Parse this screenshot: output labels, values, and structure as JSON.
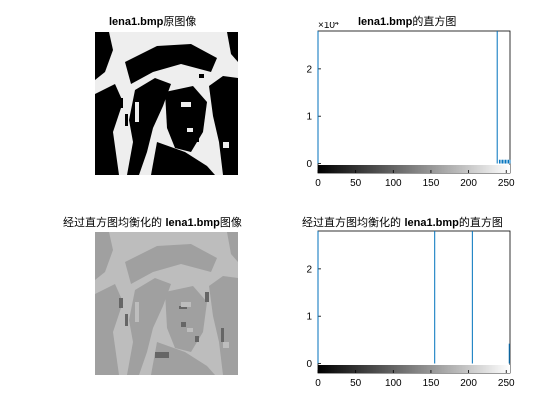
{
  "figure": {
    "titles": {
      "tl_name": "lena1.bmp",
      "tl_suffix": "原图像",
      "tr_name": "lena1.bmp",
      "tr_suffix": "的直方图",
      "bl_prefix": "经过直方图均衡化的 ",
      "bl_name": "lena1.bmp",
      "bl_suffix": "图像",
      "br_prefix": "经过直方图均衡化的 ",
      "br_name": "lena1.bmp",
      "br_suffix": "的直方图"
    }
  },
  "chart_data": [
    {
      "type": "image",
      "title": "lena1.bmp原图像",
      "description_colors": {
        "dark": "#000000",
        "light": "#eeeeee"
      }
    },
    {
      "type": "bar",
      "title": "lena1.bmp的直方图",
      "xlim": [
        0,
        255
      ],
      "ylim": [
        -0.2,
        2.8
      ],
      "y_multiplier": "×10^4",
      "y_multiplier_base": "×10",
      "y_multiplier_exp": "4",
      "x_ticks": [
        0,
        50,
        100,
        150,
        200,
        250
      ],
      "y_ticks": [
        0,
        1,
        2
      ],
      "line_color": "#0072bd",
      "series": [
        {
          "x": [
            0,
            238,
            241,
            243,
            245,
            247,
            249,
            251,
            253,
            255
          ],
          "y": [
            2.8,
            2.8,
            0.08,
            0.08,
            0.08,
            0.08,
            0.08,
            0.08,
            0.08,
            0.08
          ]
        }
      ],
      "colorbar": {
        "from": "#000000",
        "to": "#ffffff"
      }
    },
    {
      "type": "image",
      "title": "经过直方图均衡化的 lena1.bmp图像",
      "description_colors": {
        "dark": "#666666",
        "mid": "#a0a0a0",
        "light": "#bdbdbd"
      }
    },
    {
      "type": "bar",
      "title": "经过直方图均衡化的 lena1.bmp的直方图",
      "xlim": [
        0,
        255
      ],
      "ylim": [
        -0.2,
        2.8
      ],
      "x_ticks": [
        0,
        50,
        100,
        150,
        200,
        250
      ],
      "y_ticks": [
        0,
        1,
        2
      ],
      "line_color": "#0072bd",
      "series": [
        {
          "x": [
            0,
            155,
            205,
            254
          ],
          "y": [
            2.8,
            2.8,
            2.8,
            0.42
          ]
        }
      ],
      "colorbar": {
        "from": "#000000",
        "to": "#ffffff"
      }
    }
  ]
}
